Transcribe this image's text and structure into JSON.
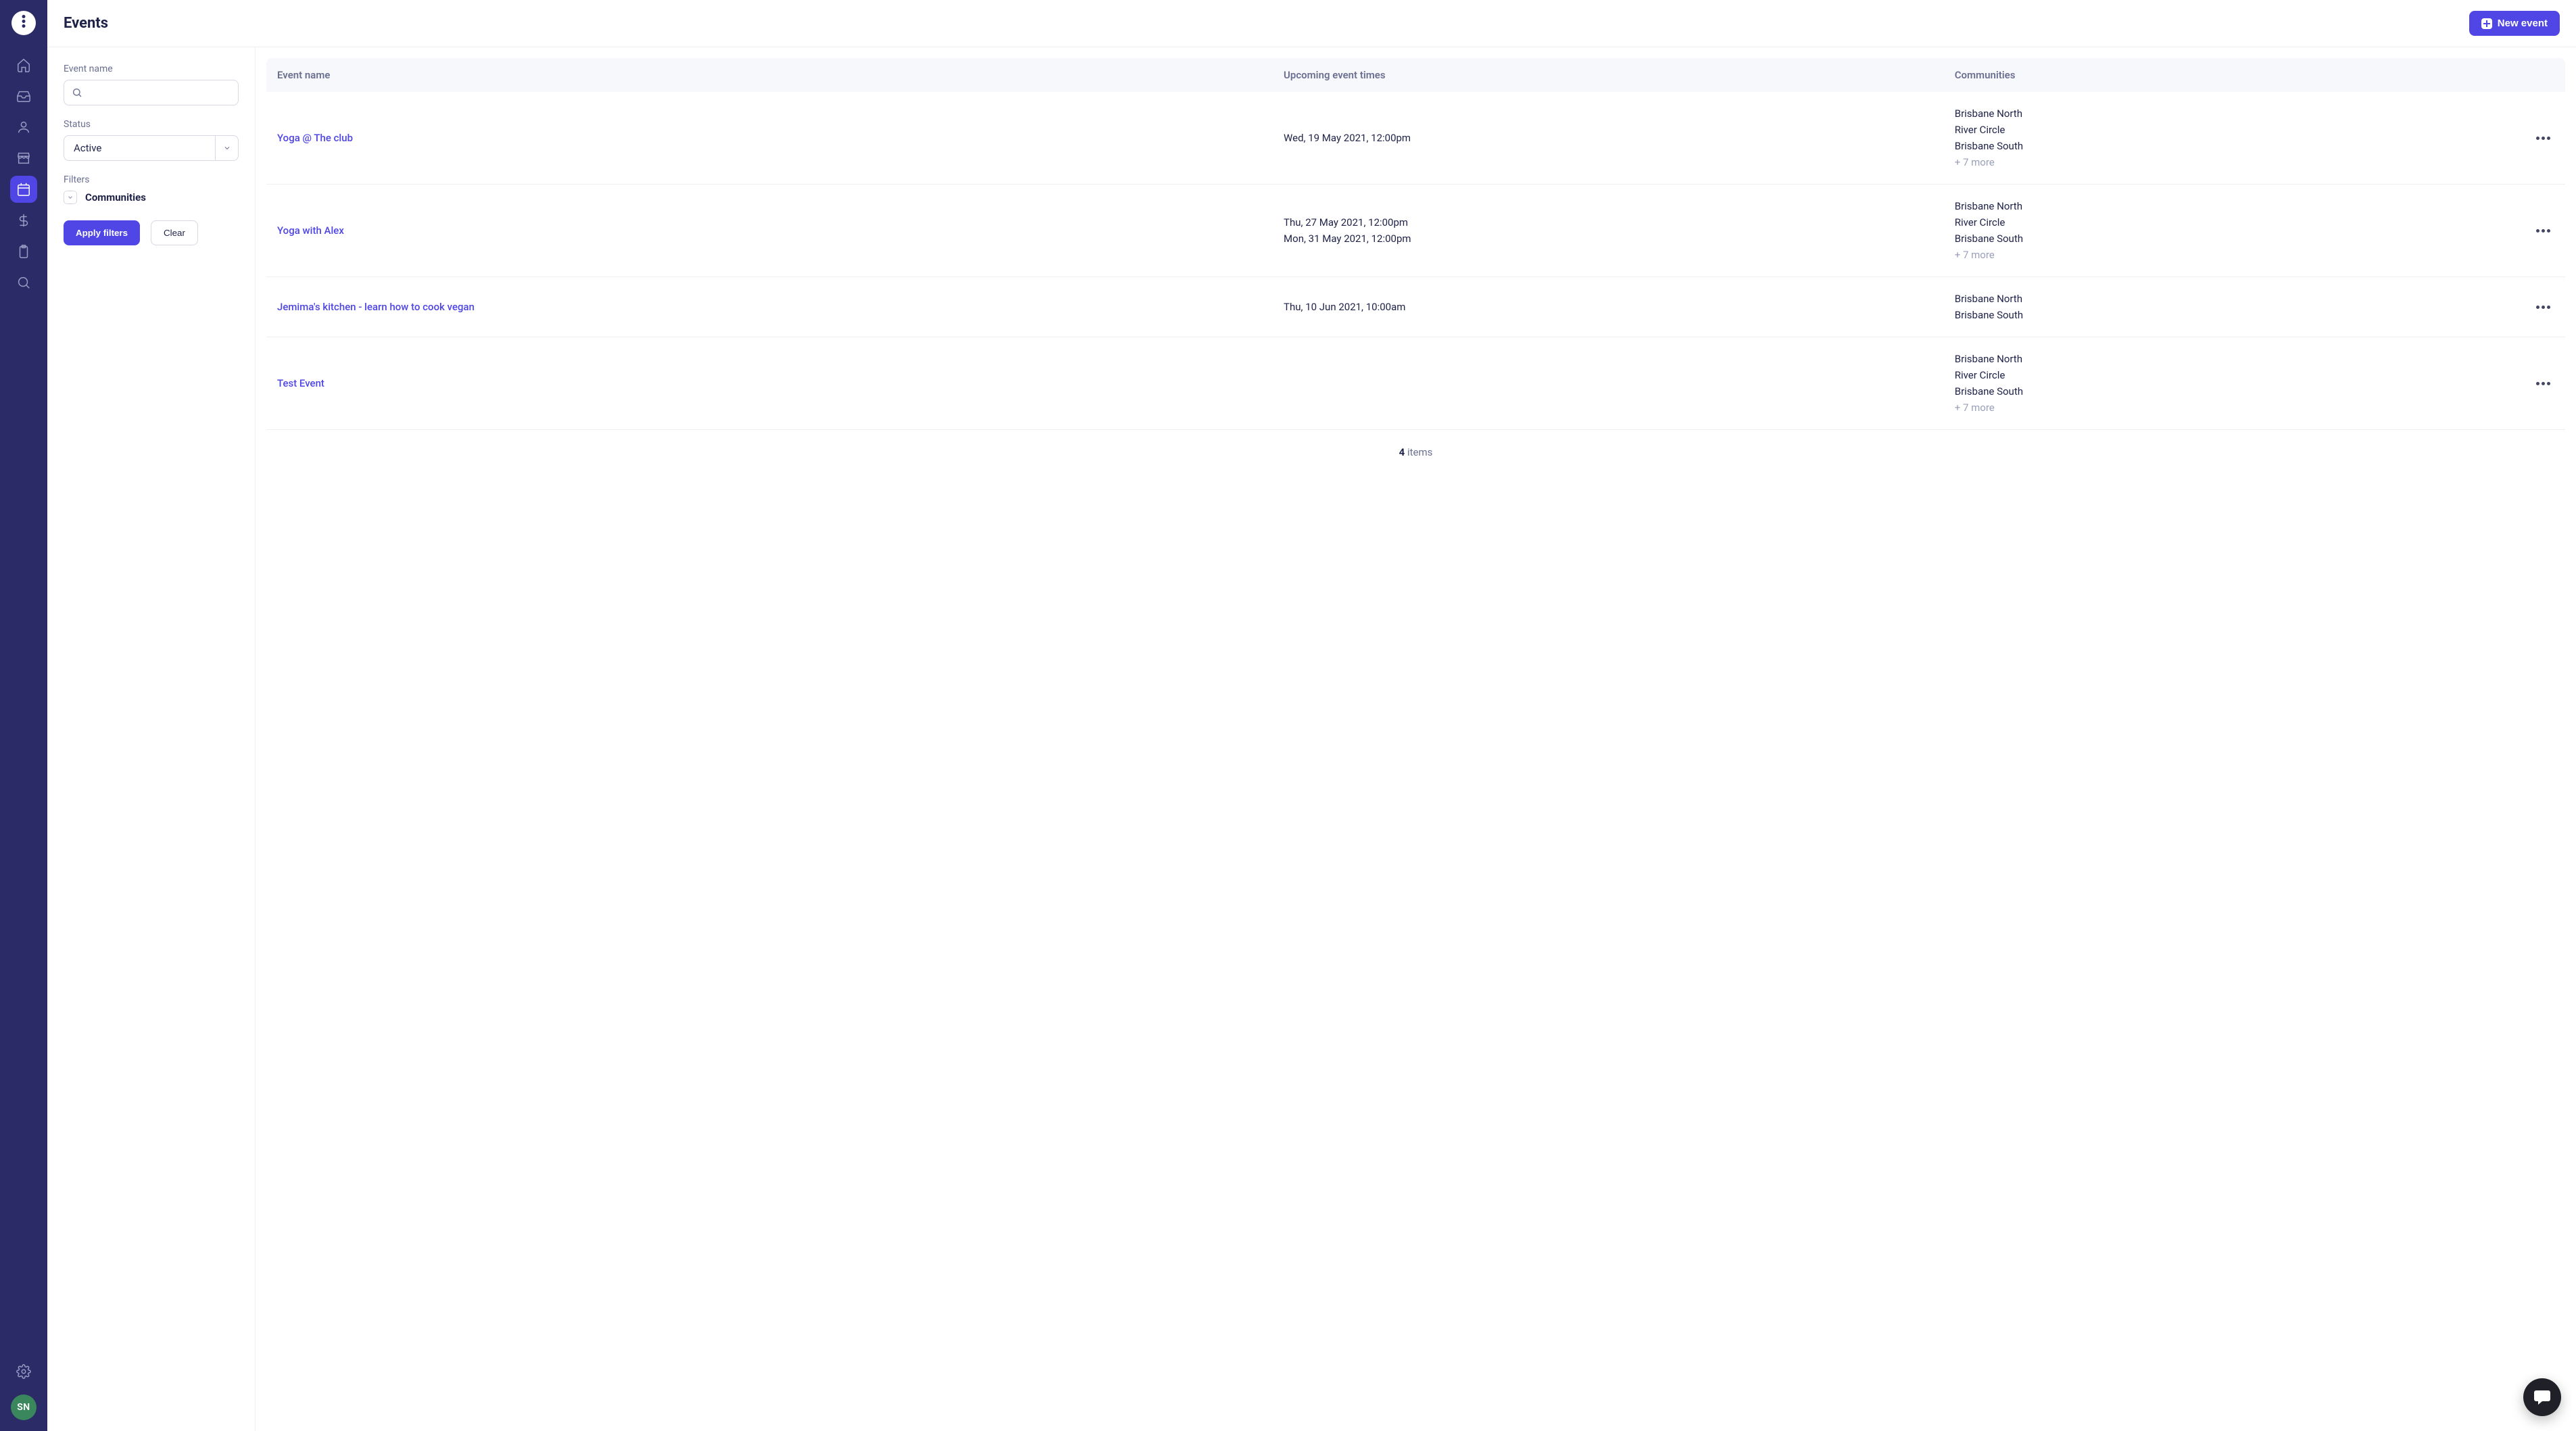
{
  "sidebar": {
    "nav": [
      "home",
      "inbox",
      "person",
      "store",
      "calendar",
      "billing",
      "clipboard",
      "search"
    ],
    "active_index": 4,
    "user_initials": "SN"
  },
  "header": {
    "page_title": "Events",
    "new_button_label": "New event"
  },
  "filters": {
    "event_name_label": "Event name",
    "event_name_value": "",
    "status_label": "Status",
    "status_value": "Active",
    "filters_label": "Filters",
    "communities_label": "Communities",
    "apply_label": "Apply filters",
    "clear_label": "Clear"
  },
  "table": {
    "columns": [
      "Event name",
      "Upcoming event times",
      "Communities"
    ],
    "rows": [
      {
        "name": "Yoga @ The club",
        "times": [
          "Wed, 19 May 2021, 12:00pm"
        ],
        "communities": [
          "Brisbane North",
          "River Circle",
          "Brisbane South"
        ],
        "more": "+ 7 more"
      },
      {
        "name": "Yoga with Alex",
        "times": [
          "Thu, 27 May 2021, 12:00pm",
          "Mon, 31 May 2021, 12:00pm"
        ],
        "communities": [
          "Brisbane North",
          "River Circle",
          "Brisbane South"
        ],
        "more": "+ 7 more"
      },
      {
        "name": "Jemima's kitchen - learn how to cook vegan",
        "times": [
          "Thu, 10 Jun 2021, 10:00am"
        ],
        "communities": [
          "Brisbane North",
          "Brisbane South"
        ],
        "more": ""
      },
      {
        "name": "Test Event",
        "times": [],
        "communities": [
          "Brisbane North",
          "River Circle",
          "Brisbane South"
        ],
        "more": "+ 7 more"
      }
    ],
    "footer_count": "4",
    "footer_label": "items"
  }
}
